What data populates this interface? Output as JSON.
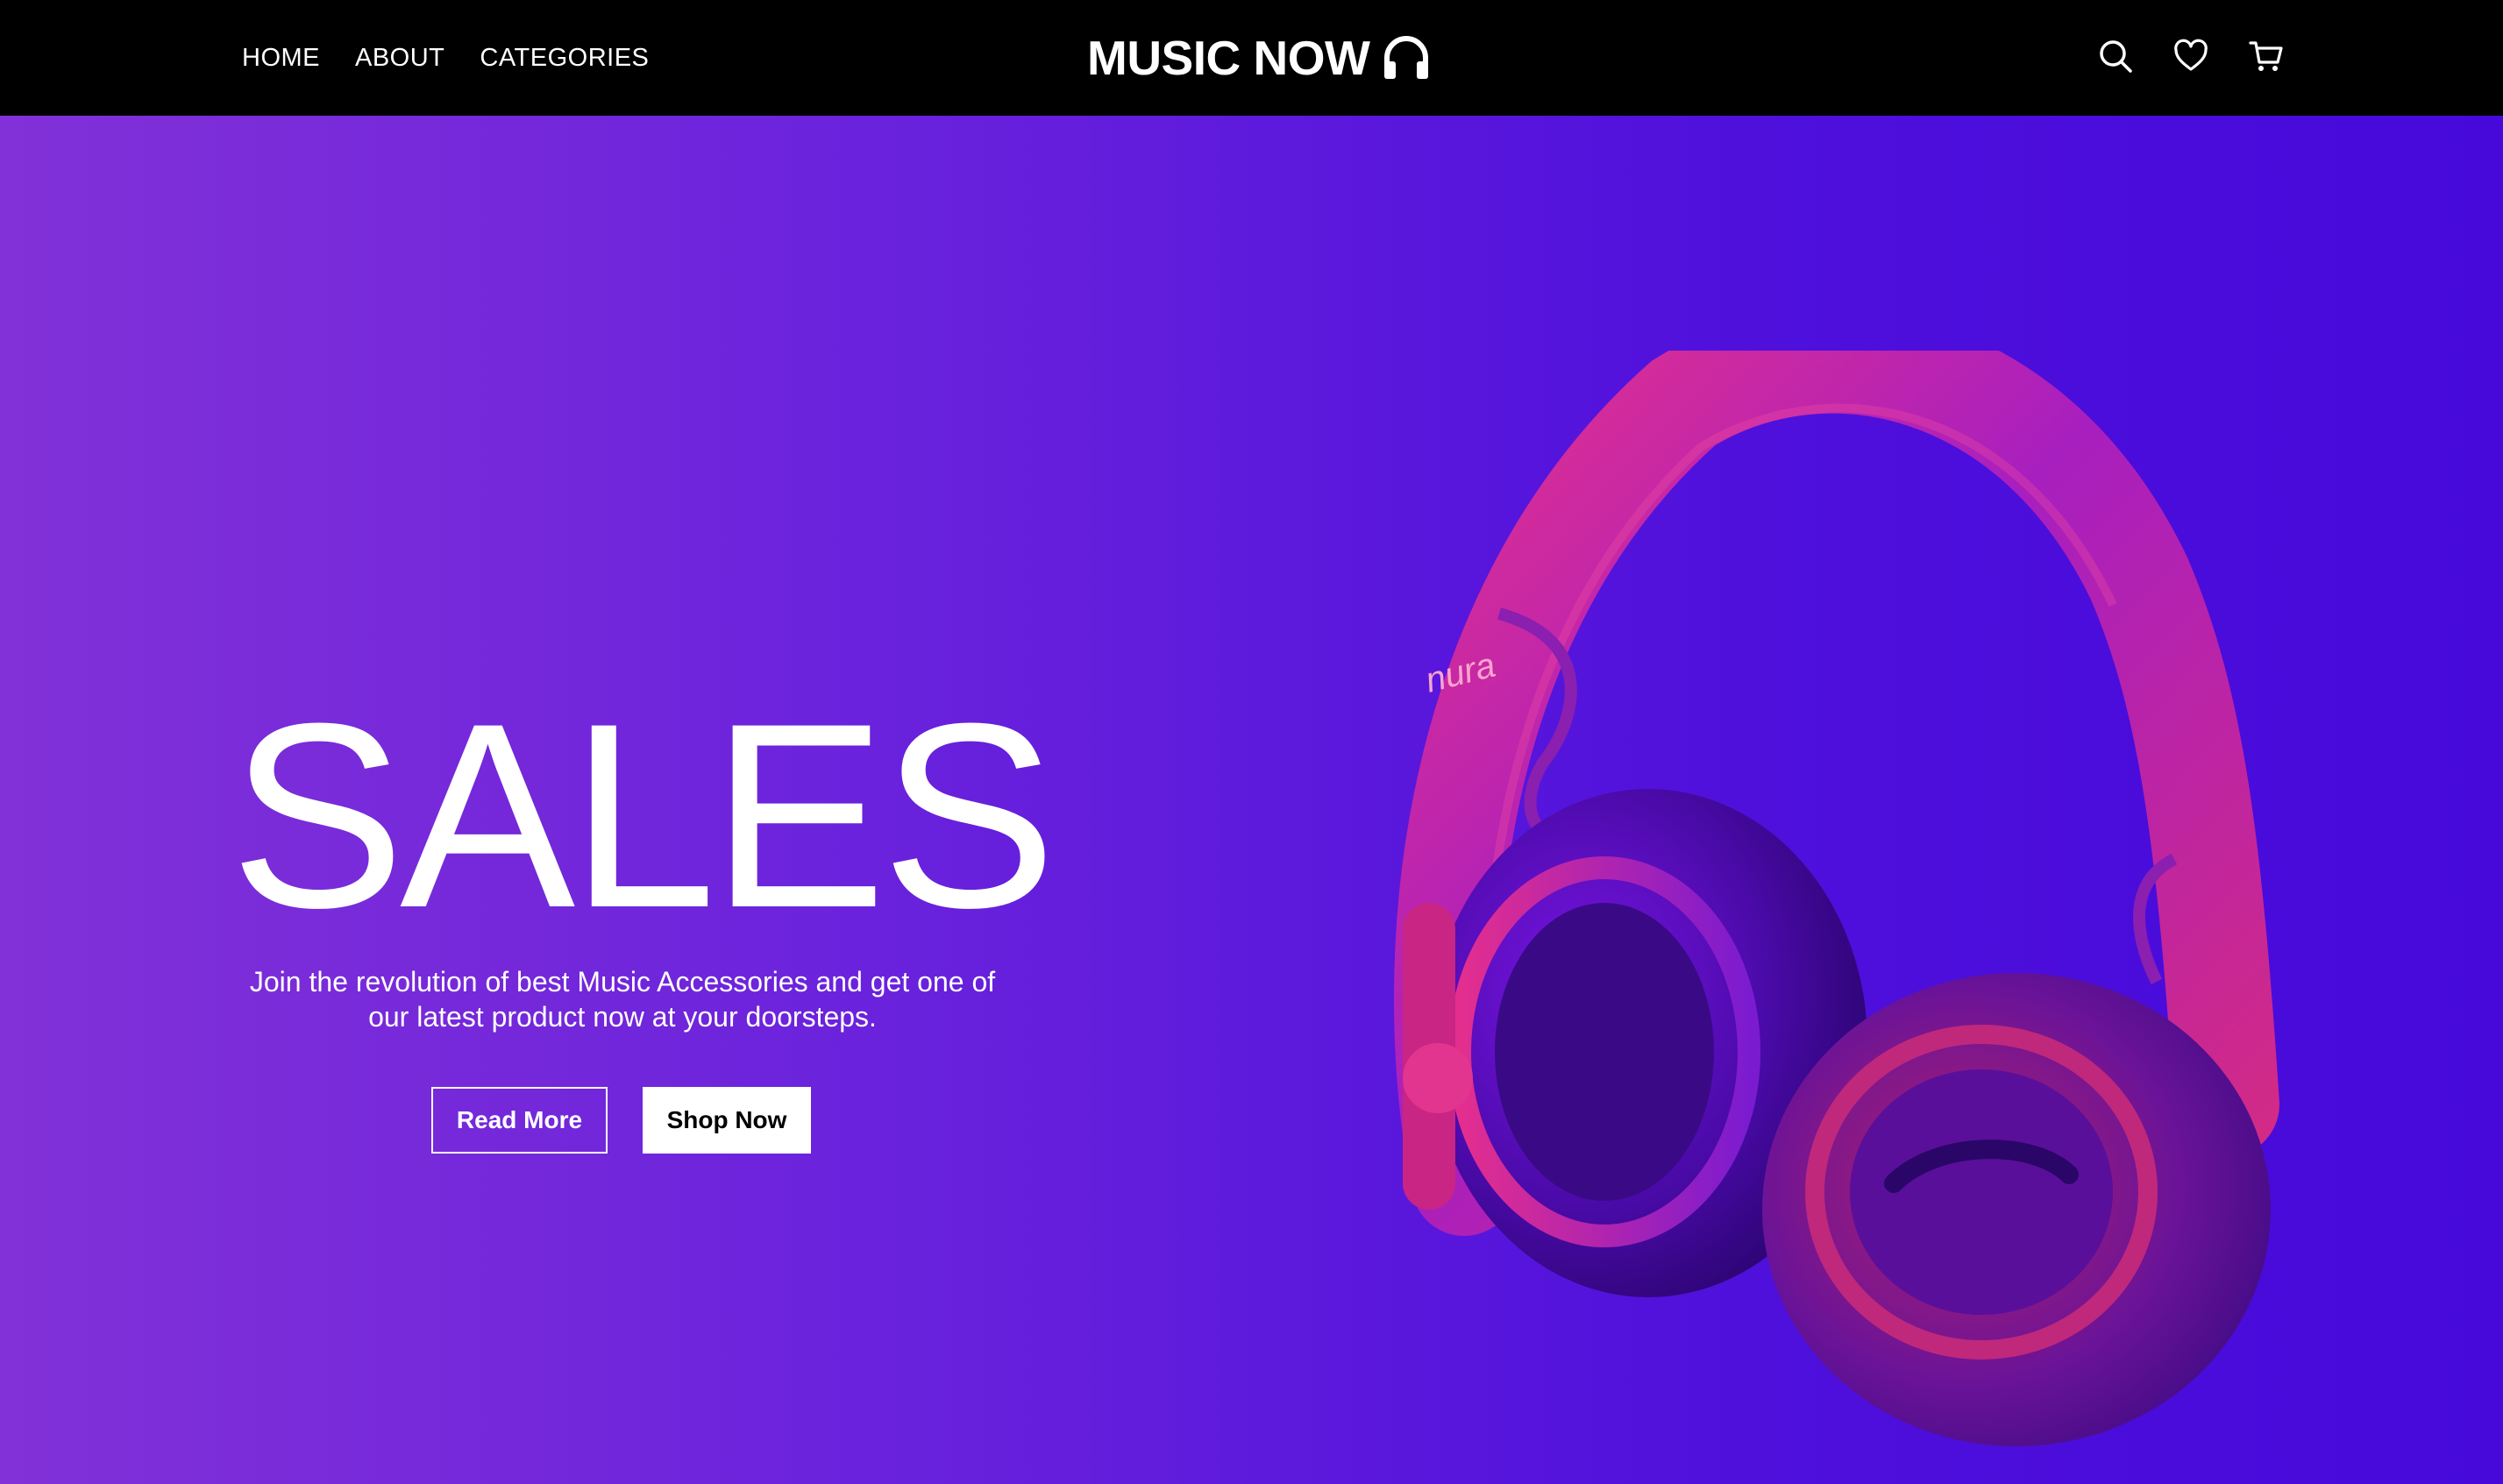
{
  "nav": {
    "links": [
      "HOME",
      "ABOUT",
      "CATEGORIES"
    ],
    "brand": "MUSIC NOW",
    "icons": [
      "search-icon",
      "heart-icon",
      "cart-icon"
    ]
  },
  "hero": {
    "title": "SALES",
    "description": "Join the revolution of best Music Accessories and get one of our latest product now at your doorsteps.",
    "read_more_label": "Read More",
    "shop_now_label": "Shop Now",
    "product_brand_mark": "nura"
  },
  "colors": {
    "navbar": "#000000",
    "gradient_start": "#8231d8",
    "gradient_end": "#4609da",
    "headphone_pink": "#e02b8a",
    "headphone_purple": "#6d12d8"
  }
}
